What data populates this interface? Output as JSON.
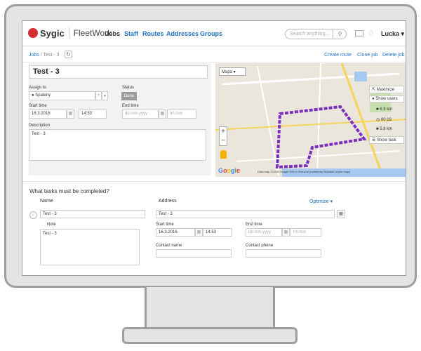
{
  "app": {
    "brand": "Sygic",
    "name": "FleetWork"
  },
  "nav": {
    "items": [
      "Jobs",
      "Staff",
      "Routes",
      "Addresses",
      "Groups"
    ],
    "active": "Jobs"
  },
  "search": {
    "placeholder": "Search anything..."
  },
  "user": {
    "name": "Lucka"
  },
  "breadcrumb": {
    "root": "Jobs",
    "separator": "/",
    "current": "Test - 3"
  },
  "actions": {
    "create_route": "Create route",
    "clone_job": "Clone job",
    "delete_job": "Delete job"
  },
  "job": {
    "title": "Test  - 3",
    "assign_label": "Assign to",
    "assignee": "Spaleny",
    "status_label": "Status",
    "status": "Done",
    "start_label": "Start time",
    "start_date": "16.3.2016",
    "start_time": "14:53",
    "end_label": "End time",
    "end_date_placeholder": "dd.mm.yyyy",
    "end_time_placeholder": "hh:mm",
    "description_label": "Description",
    "description": "Test  - 3"
  },
  "map": {
    "type": "Mapa",
    "maximize": "Maximize",
    "show_users": "Show users",
    "distance": "6.9 km",
    "duration": "00:19",
    "distance2": "5.8 km",
    "show_task": "Show task",
    "footer": "Dáta máp ©2016 Google   500 m   Zmluvné podmienky   Nahlásiť chybu mapy",
    "route_color": "#7b2fbe"
  },
  "tasks": {
    "title": "What tasks must be completed?",
    "name_header": "Name",
    "address_header": "Address",
    "optimize": "Optimize",
    "name": "Test  - 3",
    "address": "Test  - 3",
    "note_label": "Note",
    "note": "Test  - 3",
    "start_label": "Start time",
    "start_date": "16.3.2016",
    "start_time": "14:53",
    "end_label": "End time",
    "end_date_placeholder": "dd.mm.yyyy",
    "end_time_placeholder": "hh:mm",
    "contact_name_label": "Contact name",
    "contact_phone_label": "Contact phone"
  },
  "colors": {
    "accent": "#1e73c6",
    "brand_red": "#d32f2f",
    "status_done": "#9b9b9b"
  }
}
